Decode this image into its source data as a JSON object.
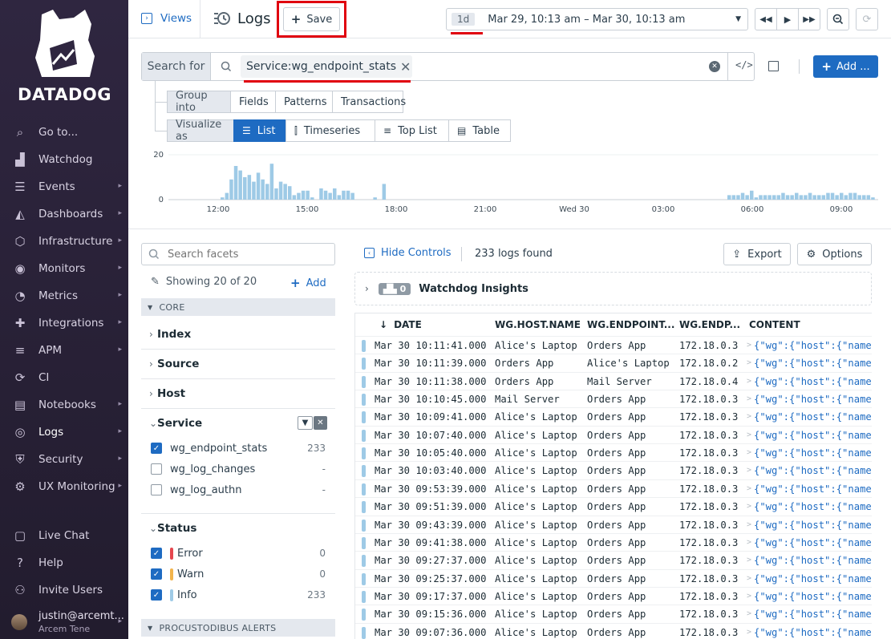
{
  "sidebar": {
    "logo_text": "DATADOG",
    "items": [
      {
        "label": "Go to...",
        "icon": "search-icon",
        "arrow": false
      },
      {
        "label": "Watchdog",
        "icon": "binoculars-icon",
        "arrow": false
      },
      {
        "label": "Events",
        "icon": "events-list-icon",
        "arrow": true
      },
      {
        "label": "Dashboards",
        "icon": "dashboard-chart-icon",
        "arrow": true
      },
      {
        "label": "Infrastructure",
        "icon": "infrastructure-icon",
        "arrow": true
      },
      {
        "label": "Monitors",
        "icon": "monitor-icon",
        "arrow": true
      },
      {
        "label": "Metrics",
        "icon": "metrics-gauge-icon",
        "arrow": true
      },
      {
        "label": "Integrations",
        "icon": "puzzle-icon",
        "arrow": true
      },
      {
        "label": "APM",
        "icon": "apm-icon",
        "arrow": true
      },
      {
        "label": "CI",
        "icon": "ci-icon",
        "arrow": false
      },
      {
        "label": "Notebooks",
        "icon": "notebook-icon",
        "arrow": true
      },
      {
        "label": "Logs",
        "icon": "logs-icon",
        "arrow": true
      },
      {
        "label": "Security",
        "icon": "shield-icon",
        "arrow": true
      },
      {
        "label": "UX Monitoring",
        "icon": "ux-monitoring-icon",
        "arrow": true
      }
    ],
    "bottom": [
      {
        "label": "Live Chat",
        "icon": "chat-icon"
      },
      {
        "label": "Help",
        "icon": "help-icon"
      },
      {
        "label": "Invite Users",
        "icon": "invite-users-icon"
      }
    ],
    "user": {
      "name": "justin@arcemt...",
      "org": "Arcem Tene"
    }
  },
  "topbar": {
    "views_label": "Views",
    "page_title": "Logs",
    "save_label": "Save",
    "time_range_short": "1d",
    "time_range": "Mar 29, 10:13 am – Mar 30, 10:13 am"
  },
  "search": {
    "label": "Search for",
    "query": "Service:wg_endpoint_stats",
    "add_label": "Add ..."
  },
  "group_into": {
    "label": "Group into",
    "options": [
      "Fields",
      "Patterns",
      "Transactions"
    ]
  },
  "visualize_as": {
    "label": "Visualize as",
    "options": [
      "List",
      "Timeseries",
      "Top List",
      "Table"
    ],
    "selected": "List"
  },
  "histogram": {
    "y_labels": [
      "20",
      "0"
    ],
    "x_labels": [
      "12:00",
      "15:00",
      "18:00",
      "21:00",
      "Wed 30",
      "03:00",
      "06:00",
      "09:00"
    ],
    "values": [
      1,
      3,
      9,
      15,
      13,
      10,
      11,
      8,
      12,
      9,
      7,
      16,
      5,
      8,
      7,
      6,
      2,
      3,
      4,
      4,
      1,
      0,
      5,
      4,
      3,
      5,
      2,
      4,
      4,
      3,
      0,
      0,
      0,
      0,
      1,
      0,
      7
    ]
  },
  "facets": {
    "search_placeholder": "Search facets",
    "showing": "Showing 20 of 20",
    "add_label": "Add",
    "core_label": "CORE",
    "groups": [
      "Index",
      "Source",
      "Host"
    ],
    "service": {
      "title": "Service",
      "values": [
        {
          "name": "wg_endpoint_stats",
          "count": "233",
          "checked": true
        },
        {
          "name": "wg_log_changes",
          "count": "-",
          "checked": false
        },
        {
          "name": "wg_log_authn",
          "count": "-",
          "checked": false
        }
      ]
    },
    "status": {
      "title": "Status",
      "values": [
        {
          "name": "Error",
          "count": "0",
          "color": "#e5474f",
          "checked": true
        },
        {
          "name": "Warn",
          "count": "0",
          "color": "#f2b44c",
          "checked": true
        },
        {
          "name": "Info",
          "count": "233",
          "color": "#9ecae6",
          "checked": true
        }
      ]
    },
    "procustodibus_label": "PROCUSTODIBUS ALERTS"
  },
  "controls": {
    "hide_controls": "Hide Controls",
    "logs_found": "233 logs found",
    "export_label": "Export",
    "options_label": "Options",
    "watchdog_label": "Watchdog Insights",
    "watchdog_count": "0"
  },
  "table": {
    "columns": [
      "DATE",
      "WG.HOST.NAME",
      "WG.ENDPOINT....",
      "WG.ENDP...",
      "CONTENT"
    ],
    "rows": [
      {
        "date": "Mar 30 10:11:41.000",
        "host": "Alice's Laptop",
        "endpoint": "Orders App",
        "ip": "172.18.0.3",
        "content": "{\"wg\":{\"host\":{\"name\""
      },
      {
        "date": "Mar 30 10:11:39.000",
        "host": "Orders App",
        "endpoint": "Alice's Laptop",
        "ip": "172.18.0.2",
        "content": "{\"wg\":{\"host\":{\"name\""
      },
      {
        "date": "Mar 30 10:11:38.000",
        "host": "Orders App",
        "endpoint": "Mail Server",
        "ip": "172.18.0.4",
        "content": "{\"wg\":{\"host\":{\"name\""
      },
      {
        "date": "Mar 30 10:10:45.000",
        "host": "Mail Server",
        "endpoint": "Orders App",
        "ip": "172.18.0.3",
        "content": "{\"wg\":{\"host\":{\"name\""
      },
      {
        "date": "Mar 30 10:09:41.000",
        "host": "Alice's Laptop",
        "endpoint": "Orders App",
        "ip": "172.18.0.3",
        "content": "{\"wg\":{\"host\":{\"name\""
      },
      {
        "date": "Mar 30 10:07:40.000",
        "host": "Alice's Laptop",
        "endpoint": "Orders App",
        "ip": "172.18.0.3",
        "content": "{\"wg\":{\"host\":{\"name\""
      },
      {
        "date": "Mar 30 10:05:40.000",
        "host": "Alice's Laptop",
        "endpoint": "Orders App",
        "ip": "172.18.0.3",
        "content": "{\"wg\":{\"host\":{\"name\""
      },
      {
        "date": "Mar 30 10:03:40.000",
        "host": "Alice's Laptop",
        "endpoint": "Orders App",
        "ip": "172.18.0.3",
        "content": "{\"wg\":{\"host\":{\"name\""
      },
      {
        "date": "Mar 30 09:53:39.000",
        "host": "Alice's Laptop",
        "endpoint": "Orders App",
        "ip": "172.18.0.3",
        "content": "{\"wg\":{\"host\":{\"name\""
      },
      {
        "date": "Mar 30 09:51:39.000",
        "host": "Alice's Laptop",
        "endpoint": "Orders App",
        "ip": "172.18.0.3",
        "content": "{\"wg\":{\"host\":{\"name\""
      },
      {
        "date": "Mar 30 09:43:39.000",
        "host": "Alice's Laptop",
        "endpoint": "Orders App",
        "ip": "172.18.0.3",
        "content": "{\"wg\":{\"host\":{\"name\""
      },
      {
        "date": "Mar 30 09:41:38.000",
        "host": "Alice's Laptop",
        "endpoint": "Orders App",
        "ip": "172.18.0.3",
        "content": "{\"wg\":{\"host\":{\"name\""
      },
      {
        "date": "Mar 30 09:27:37.000",
        "host": "Alice's Laptop",
        "endpoint": "Orders App",
        "ip": "172.18.0.3",
        "content": "{\"wg\":{\"host\":{\"name\""
      },
      {
        "date": "Mar 30 09:25:37.000",
        "host": "Alice's Laptop",
        "endpoint": "Orders App",
        "ip": "172.18.0.3",
        "content": "{\"wg\":{\"host\":{\"name\""
      },
      {
        "date": "Mar 30 09:17:37.000",
        "host": "Alice's Laptop",
        "endpoint": "Orders App",
        "ip": "172.18.0.3",
        "content": "{\"wg\":{\"host\":{\"name\""
      },
      {
        "date": "Mar 30 09:15:36.000",
        "host": "Alice's Laptop",
        "endpoint": "Orders App",
        "ip": "172.18.0.3",
        "content": "{\"wg\":{\"host\":{\"name\""
      },
      {
        "date": "Mar 30 09:07:36.000",
        "host": "Alice's Laptop",
        "endpoint": "Orders App",
        "ip": "172.18.0.3",
        "content": "{\"wg\":{\"host\":{\"name\""
      }
    ]
  },
  "colors": {
    "accent": "#1e6bc2",
    "sidebar": "#2f2640",
    "highlight": "#e0000f",
    "info": "#9ecae6"
  }
}
